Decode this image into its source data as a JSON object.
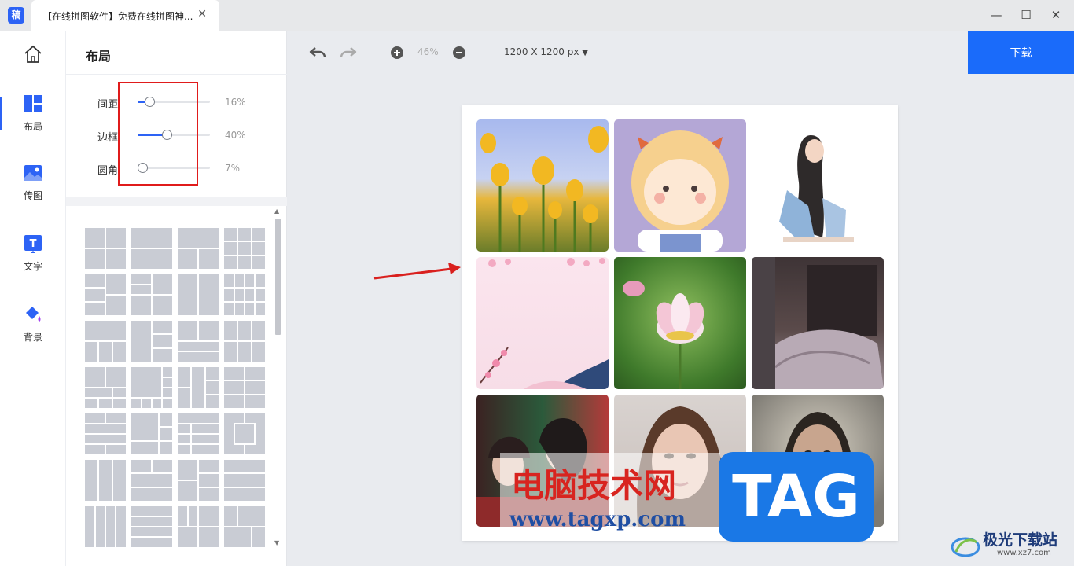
{
  "app": {
    "logo_char": "稿",
    "tab_title": "【在线拼图软件】免费在线拼图神...",
    "tab_close": "✕"
  },
  "window": {
    "minimize": "—",
    "maximize": "☐",
    "close": "✕"
  },
  "nav": {
    "items": [
      {
        "label": "",
        "icon": "home-icon"
      },
      {
        "label": "布局",
        "icon": "layout-icon"
      },
      {
        "label": "传图",
        "icon": "image-upload-icon"
      },
      {
        "label": "文字",
        "icon": "text-icon"
      },
      {
        "label": "背景",
        "icon": "background-fill-icon"
      }
    ]
  },
  "panel": {
    "title": "布局",
    "sliders": [
      {
        "label": "间距",
        "value": 16,
        "value_text": "16%"
      },
      {
        "label": "边框",
        "value": 40,
        "value_text": "40%"
      },
      {
        "label": "圆角",
        "value": 7,
        "value_text": "7%"
      }
    ]
  },
  "toolbar": {
    "zoom": "46%",
    "size": "1200 X 1200 px",
    "download": "下载"
  },
  "watermark": {
    "site_name": "电脑技术网",
    "url": "www.tagxp.com",
    "tag": "TAG",
    "corner_name": "极光下载站",
    "corner_url": "www.xz7.com"
  },
  "colors": {
    "accent": "#2d63f5",
    "download": "#1a6bfa",
    "annotation": "#e01b1b"
  }
}
